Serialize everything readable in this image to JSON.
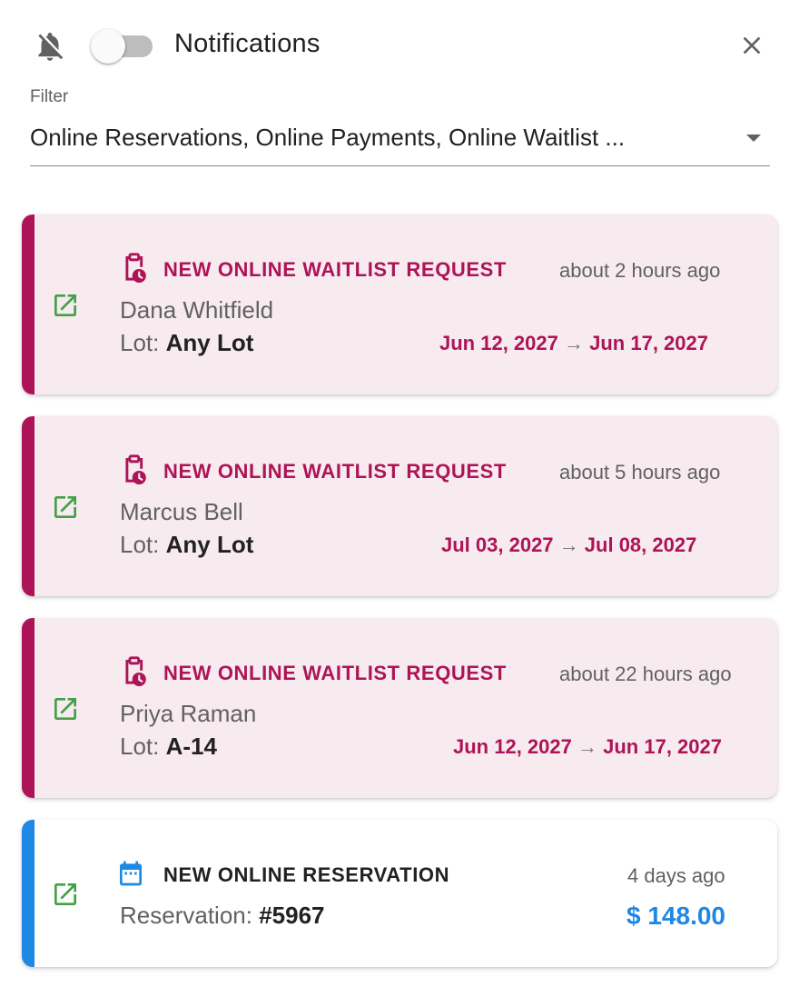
{
  "header": {
    "title": "Notifications",
    "toggle_on": false,
    "bell_icon": "bell-off-icon",
    "close_icon": "close-icon"
  },
  "filter": {
    "label": "Filter",
    "value": "Online Reservations, Online Payments, Online Waitlist ..."
  },
  "colors": {
    "waitlist_accent": "#ad1457",
    "waitlist_bg": "#f8ebef",
    "reservation_accent": "#1e88e5",
    "open_icon": "#43a047"
  },
  "notifications": [
    {
      "type": "NEW ONLINE WAITLIST REQUEST",
      "icon": "waitlist-clock-icon",
      "time": "about 2 hours ago",
      "name": "Dana Whitfield",
      "lot_label": "Lot:",
      "lot_value": "Any Lot",
      "date_from": "Jun 12, 2027",
      "arrow": "→",
      "date_to": "Jun 17, 2027"
    },
    {
      "type": "NEW ONLINE WAITLIST REQUEST",
      "icon": "waitlist-clock-icon",
      "time": "about 5 hours ago",
      "name": "Marcus Bell",
      "lot_label": "Lot:",
      "lot_value": "Any Lot",
      "date_from": "Jul 03, 2027",
      "arrow": "→",
      "date_to": "Jul 08, 2027"
    },
    {
      "type": "NEW ONLINE WAITLIST REQUEST",
      "icon": "waitlist-clock-icon",
      "time": "about 22 hours ago",
      "name": "Priya Raman",
      "lot_label": "Lot:",
      "lot_value": "A-14",
      "date_from": "Jun 12, 2027",
      "arrow": "→",
      "date_to": "Jun 17, 2027"
    },
    {
      "type": "NEW ONLINE RESERVATION",
      "icon": "calendar-icon",
      "time": "4 days ago",
      "reservation_label": "Reservation:",
      "reservation_value": "#5967",
      "amount": "$ 148.00"
    }
  ]
}
